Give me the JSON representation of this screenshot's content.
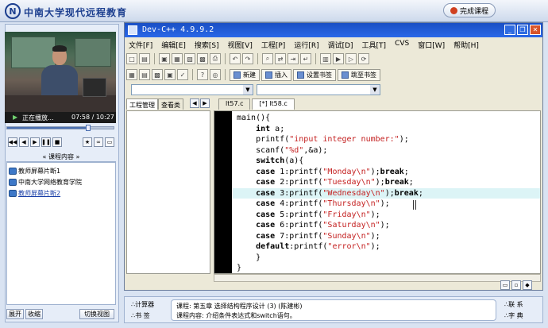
{
  "topbar": {
    "logo_mark": "N",
    "logo_text": "中南大学现代远程教育",
    "finish_button": "完成课程"
  },
  "player": {
    "status": "正在播放...",
    "time": "07:58 / 10:27",
    "progress": 0.76
  },
  "course_panel": {
    "title": "课程内容",
    "items": [
      {
        "label": "教师屏幕片断1"
      },
      {
        "label": "中南大学网络教育学院"
      },
      {
        "label": "教师屏幕片断2"
      }
    ],
    "expand_button": "展开",
    "collapse_button": "收缩",
    "switch_view_button": "切换视图"
  },
  "devcpp": {
    "title": "Dev-C++ 4.9.9.2",
    "menu": [
      "文件[F]",
      "编辑[E]",
      "搜索[S]",
      "视图[V]",
      "工程[P]",
      "运行[R]",
      "调试[D]",
      "工具[T]",
      "CVS",
      "窗口[W]",
      "帮助[H]"
    ],
    "toolbar": {
      "new_label": "新建",
      "insert_label": "插入",
      "set_bookmark_label": "设置书签",
      "goto_bookmark_label": "跳至书签"
    },
    "project_tabs": [
      "工程管理",
      "查看类"
    ],
    "file_tabs": [
      "lt57.c",
      "[*] lt58.c"
    ],
    "code_lines": [
      "main(){",
      "    int a;",
      "    printf(\"input integer number:\");",
      "    scanf(\"%d\",&a);",
      "    switch(a){",
      "    case 1:printf(\"Monday\\n\");break;",
      "    case 2:printf(\"Tuesday\\n\");break;",
      "    case 3:printf(\"Wednesday\\n\");break;",
      "    case 4:printf(\"Thursday\\n\");",
      "    case 5:printf(\"Friday\\n\");",
      "    case 6:printf(\"Saturday\\n\");",
      "    case 7:printf(\"Sunday\\n\");",
      "    default:printf(\"error\\n\");",
      "    }",
      "}"
    ],
    "highlighted_line": 7
  },
  "bottom": {
    "calculator": "∴计算器",
    "bookmark": "∴书  签",
    "course_line": "课程: 第五章 选择结构程序设计 (3)  (陈建彬)",
    "content_line": "课程内容: 介绍条件表达式和switch语句。",
    "contact": "∴联  系",
    "dictionary": "∴字  典"
  }
}
